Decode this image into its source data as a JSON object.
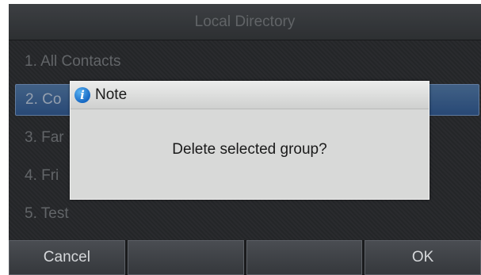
{
  "screen": {
    "title": "Local Directory"
  },
  "list": {
    "items": [
      {
        "label": "1. All Contacts"
      },
      {
        "label": "2. Co"
      },
      {
        "label": "3. Far"
      },
      {
        "label": "4. Fri"
      },
      {
        "label": "5. Test"
      }
    ],
    "selected_index": 1
  },
  "dialog": {
    "icon": "info-icon",
    "title": "Note",
    "message": "Delete selected group?"
  },
  "softkeys": [
    {
      "label": "Cancel"
    },
    {
      "label": ""
    },
    {
      "label": ""
    },
    {
      "label": "OK"
    }
  ],
  "colors": {
    "screen_bg": "#2b2d30",
    "selection": "#3a5f90",
    "dialog_bg": "#d8d9d8",
    "info_icon": "#1f7ad6"
  }
}
